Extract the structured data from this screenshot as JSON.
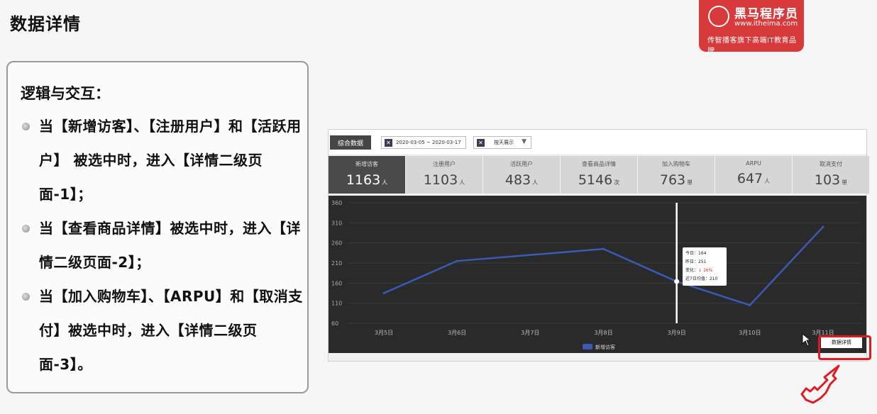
{
  "page_title": "数据详情",
  "brand": {
    "name": "黑马程序员",
    "url": "www.itheima.com",
    "slogan": "传智播客旗下高端IT教育品牌",
    "color": "#d8393a"
  },
  "logic": {
    "heading": "逻辑与交互：",
    "items": [
      "当【新增访客】、【注册用户】和【活跃用户】 被选中时，进入【详情二级页面-1】；",
      "当【查看商品详情】被选中时，进入【详情二级页面-2】；",
      "当【加入购物车】、【ARPU】和【取消支付】被选中时，进入【详情二级页面-3】。"
    ]
  },
  "dashboard": {
    "tab_label": "综合数据",
    "date_range": "2020-03-05 ~ 2020-03-17",
    "display_mode": "按天展示",
    "metrics": [
      {
        "label": "新增访客",
        "value": "1163",
        "unit": "人",
        "active": true
      },
      {
        "label": "注册用户",
        "value": "1103",
        "unit": "人",
        "active": false
      },
      {
        "label": "活跃用户",
        "value": "483",
        "unit": "人",
        "active": false
      },
      {
        "label": "查看商品详情",
        "value": "5146",
        "unit": "次",
        "active": false
      },
      {
        "label": "加入购物车",
        "value": "763",
        "unit": "単",
        "active": false
      },
      {
        "label": "ARPU",
        "value": "647",
        "unit": "人",
        "active": false
      },
      {
        "label": "取消支付",
        "value": "103",
        "unit": "単",
        "active": false
      }
    ],
    "tooltip": {
      "today": "今日：164",
      "yesterday": "昨日：251",
      "change_label": "变化：",
      "change_value": "↓ 16%",
      "avg": "近7日均值：210"
    },
    "detail_button": "数据详情"
  },
  "chart_data": {
    "type": "line",
    "x": [
      "3月5日",
      "3月6日",
      "3月7日",
      "3月8日",
      "3月9日",
      "3月10日",
      "3月11日"
    ],
    "series": [
      {
        "name": "新增访客",
        "values": [
          135,
          215,
          230,
          245,
          164,
          105,
          300
        ],
        "color": "#3a5bb5"
      }
    ],
    "y_ticks": [
      "60",
      "110",
      "160",
      "210",
      "260",
      "310",
      "360"
    ],
    "ylim": [
      60,
      360
    ],
    "highlight_x": "3月9日"
  }
}
